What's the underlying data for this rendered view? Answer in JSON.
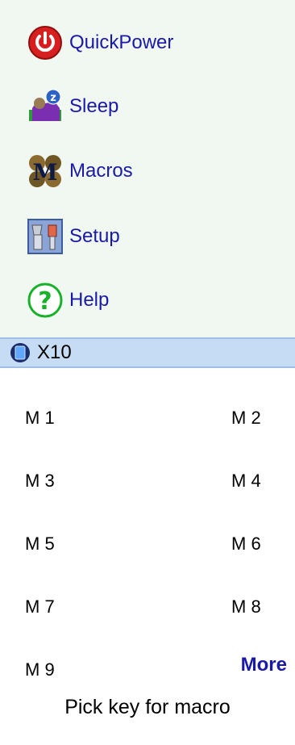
{
  "menu": {
    "items": [
      {
        "label": "QuickPower",
        "icon": "power-icon"
      },
      {
        "label": "Sleep",
        "icon": "sleep-icon"
      },
      {
        "label": "Macros",
        "icon": "macros-icon"
      },
      {
        "label": "Setup",
        "icon": "setup-icon"
      },
      {
        "label": "Help",
        "icon": "help-icon"
      }
    ]
  },
  "device": {
    "label": "X10",
    "icon": "x10-device-icon"
  },
  "macros": [
    "M 1",
    "M 2",
    "M 3",
    "M 4",
    "M 5",
    "M 6",
    "M 7",
    "M 8",
    "M 9"
  ],
  "more_label": "More",
  "status_text": "Pick key for macro",
  "colors": {
    "menu_bg": "#f1f7f1",
    "link_blue": "#1a1aa8",
    "selected_bar": "#c6dcf5"
  }
}
